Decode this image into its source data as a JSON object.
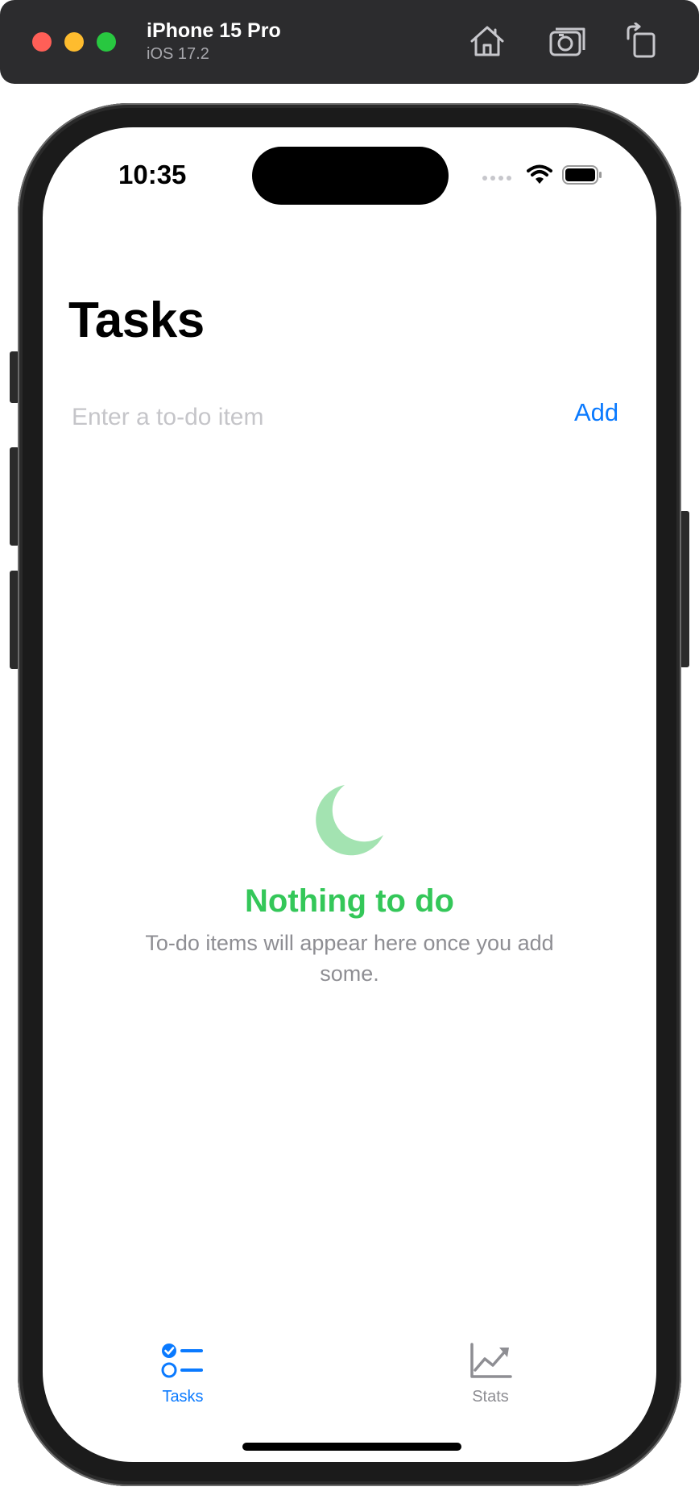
{
  "simulator": {
    "device_name": "iPhone 15 Pro",
    "os_version": "iOS 17.2",
    "home_icon": "home-icon",
    "screenshot_icon": "camera-icon",
    "rotate_icon": "rotate-icon"
  },
  "status_bar": {
    "time": "10:35",
    "signal_icon": "cellular-signal-icon",
    "wifi_icon": "wifi-icon",
    "battery_icon": "battery-icon"
  },
  "header": {
    "title": "Tasks"
  },
  "todo_entry": {
    "placeholder": "Enter a to-do item",
    "value": "",
    "add_label": "Add"
  },
  "empty_state": {
    "icon": "moon-icon",
    "title": "Nothing to do",
    "description": "To-do items will appear here once you add some."
  },
  "tab_bar": {
    "tabs": [
      {
        "label": "Tasks",
        "icon": "checklist-icon",
        "selected": true
      },
      {
        "label": "Stats",
        "icon": "chart-icon",
        "selected": false
      }
    ]
  },
  "colors": {
    "accent": "#0a7aff",
    "empty_title": "#34c759",
    "moon": "#a3e3b1",
    "secondary_text": "#8e8e93",
    "placeholder": "#c5c5c9"
  }
}
